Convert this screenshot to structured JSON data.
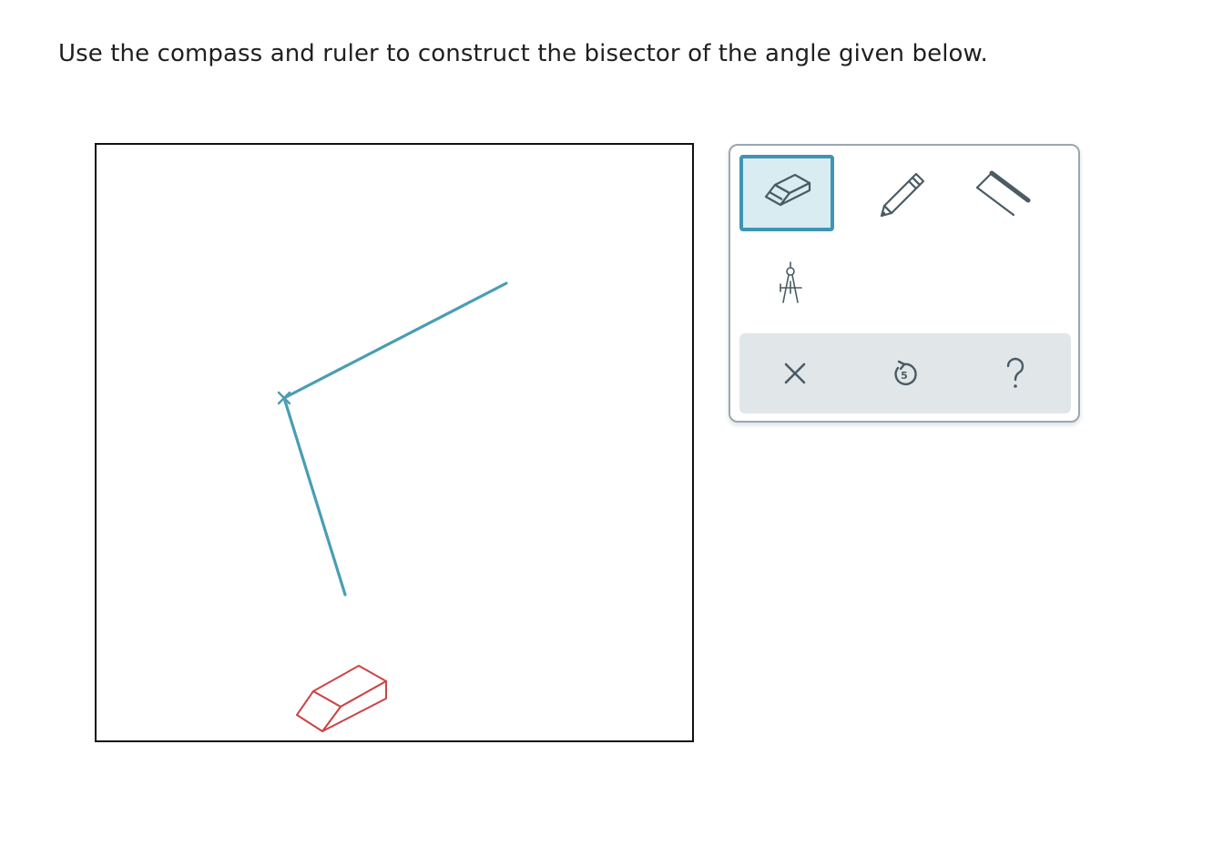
{
  "prompt": {
    "text": "Use the compass and ruler to construct the bisector of the angle given below."
  },
  "canvas": {
    "angle_color": "#4a9db5",
    "cursor_tool": "eraser-icon",
    "cursor_color": "#cc4444"
  },
  "toolbar": {
    "selected_tool": "eraser",
    "tools": [
      {
        "name": "eraser",
        "icon": "eraser-icon",
        "selected": true
      },
      {
        "name": "pencil",
        "icon": "pencil-icon",
        "selected": false
      },
      {
        "name": "ruler",
        "icon": "ruler-icon",
        "selected": false
      },
      {
        "name": "compass",
        "icon": "compass-icon",
        "selected": false
      }
    ],
    "actions": [
      {
        "name": "clear",
        "icon": "close-icon"
      },
      {
        "name": "undo",
        "icon": "undo-icon"
      },
      {
        "name": "help",
        "icon": "help-icon"
      }
    ],
    "accent_color": "#3f95b3",
    "icon_color": "#4a5b64"
  }
}
